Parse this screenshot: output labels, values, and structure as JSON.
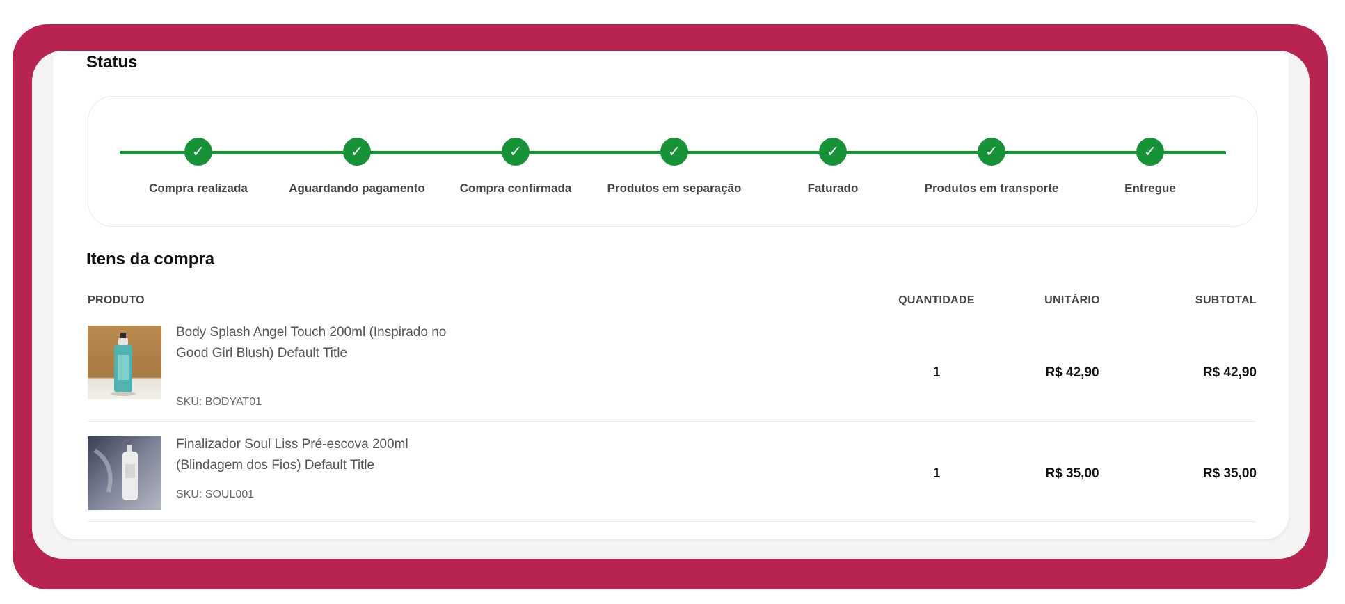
{
  "status": {
    "title": "Status",
    "steps": [
      {
        "label": "Compra realizada",
        "done": true
      },
      {
        "label": "Aguardando pagamento",
        "done": true
      },
      {
        "label": "Compra confirmada",
        "done": true
      },
      {
        "label": "Produtos em separação",
        "done": true
      },
      {
        "label": "Faturado",
        "done": true
      },
      {
        "label": "Produtos em transporte",
        "done": true
      },
      {
        "label": "Entregue",
        "done": true
      }
    ]
  },
  "items": {
    "title": "Itens da compra",
    "columns": {
      "product": "PRODUTO",
      "quantity": "QUANTIDADE",
      "unit": "UNITÁRIO",
      "subtotal": "SUBTOTAL"
    },
    "rows": [
      {
        "name": "Body Splash Angel Touch 200ml (Inspirado no Good Girl Blush) Default Title",
        "sku": "SKU: BODYAT01",
        "quantity": "1",
        "unit_price": "R$ 42,90",
        "subtotal": "R$ 42,90",
        "image": "body-splash-bottle"
      },
      {
        "name": "Finalizador Soul Liss Pré-escova 200ml (Blindagem dos Fios) Default Title",
        "sku": "SKU: SOUL001",
        "quantity": "1",
        "unit_price": "R$ 35,00",
        "subtotal": "R$ 35,00",
        "image": "finalizador-spray-bottle"
      }
    ]
  },
  "colors": {
    "frame": "#b9234f",
    "progress": "#179337",
    "background": "#f4f4f4"
  }
}
